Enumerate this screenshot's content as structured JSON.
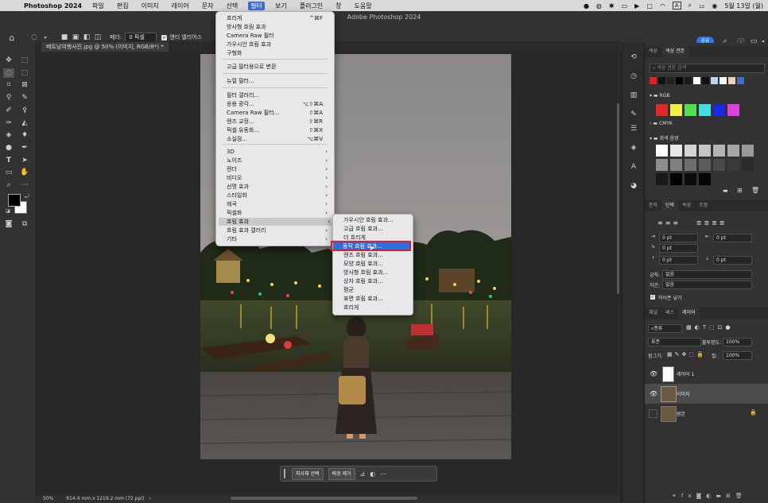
{
  "menubar": {
    "app_name": "Photoshop 2024",
    "items": [
      "파일",
      "편집",
      "이미지",
      "레이어",
      "문자",
      "선택",
      "필터",
      "보기",
      "플러그인",
      "창",
      "도움말"
    ],
    "active_index": 6,
    "status_icons": [
      "record-icon",
      "app-icon",
      "bluetooth-icon",
      "display-icon",
      "play-icon",
      "screen-icon",
      "wifi-icon",
      "input-icon",
      "search-icon",
      "control-center-icon",
      "siri-icon"
    ],
    "input_label": "A",
    "clock": "5월 13일 (월)"
  },
  "optbar": {
    "window_title": "Adobe Photoshop 2024",
    "feather_label": "페더:",
    "feather_value": "0 픽셀",
    "antialias_label": "앤티 앨리어스",
    "share_label": "공유"
  },
  "document": {
    "tab_label": "베트남여행사진.jpg @ 50% (이미지, RGB/8*) *"
  },
  "status": {
    "zoom": "50%",
    "info": "914.4 mm x 1219.2 mm (72 ppi)"
  },
  "contextbar": {
    "select_subject": "피사체 선택",
    "remove_bg": "배경 제거"
  },
  "filter_menu": {
    "items": [
      {
        "label": "흐리게",
        "shortcut": "^⌘F"
      },
      {
        "label": "방사형 흐림 효과",
        "shortcut": ""
      },
      {
        "label": "Camera Raw 필터",
        "shortcut": ""
      },
      {
        "label": "가우시안 흐림 효과",
        "shortcut": ""
      },
      {
        "label": "구형화",
        "shortcut": ""
      },
      {
        "label": "고급 필터용으로 변환",
        "shortcut": ""
      },
      {
        "label": "뉴럴 필터...",
        "shortcut": ""
      },
      {
        "label": "필터 갤러리...",
        "shortcut": ""
      },
      {
        "label": "응용 광각...",
        "shortcut": "⌥⇧⌘A"
      },
      {
        "label": "Camera Raw 필터...",
        "shortcut": "⇧⌘A"
      },
      {
        "label": "렌즈 교정...",
        "shortcut": "⇧⌘R"
      },
      {
        "label": "픽셀 유동화...",
        "shortcut": "⇧⌘X"
      },
      {
        "label": "소실점...",
        "shortcut": "⌥⌘V"
      },
      {
        "label": "3D",
        "shortcut": ""
      },
      {
        "label": "노이즈",
        "shortcut": ""
      },
      {
        "label": "렌더",
        "shortcut": ""
      },
      {
        "label": "비디오",
        "shortcut": ""
      },
      {
        "label": "선명 효과",
        "shortcut": ""
      },
      {
        "label": "스타일화",
        "shortcut": ""
      },
      {
        "label": "왜곡",
        "shortcut": ""
      },
      {
        "label": "픽셀화",
        "shortcut": ""
      },
      {
        "label": "흐림 효과",
        "shortcut": ""
      },
      {
        "label": "흐림 효과 갤러리",
        "shortcut": ""
      },
      {
        "label": "기타",
        "shortcut": ""
      }
    ]
  },
  "blur_submenu": {
    "items": [
      "가우시안 흐림 효과...",
      "고급 흐림 효과...",
      "더 흐리게",
      "동작 흐림 효과...",
      "렌즈 흐림 효과...",
      "모양 흐림 효과...",
      "방사형 흐림 효과...",
      "상자 흐림 효과...",
      "평균",
      "표면 흐림 효과...",
      "흐리게"
    ],
    "selected_index": 3
  },
  "swatches_panel": {
    "tabs": [
      "색상",
      "색상 견본"
    ],
    "search_placeholder": "색상 견본 검색",
    "recent_colors": [
      "#e02020",
      "#111111",
      "#222222",
      "#000000",
      "#1a1a1a",
      "#ffffff",
      "#111111",
      "#b8d8f0",
      "#ffffff",
      "#f0d0b0",
      "#4070c0"
    ],
    "group_rgb": "RGB",
    "rgb_colors": [
      "#e02a2a",
      "#f0f040",
      "#50e050",
      "#40e0e0",
      "#1a28e0",
      "#e040e0"
    ],
    "group_cmyk": "CMYK",
    "group_gray": "회색 음영",
    "gray_colors": [
      "#ffffff",
      "#e8e8e8",
      "#d4d4d4",
      "#c4c4c4",
      "#b4b4b4",
      "#a6a6a6",
      "#9a9a9a",
      "#8e8e8e",
      "#808080",
      "#6e6e6e",
      "#5c5c5c",
      "#4a4a4a",
      "#3a3a3a",
      "#2a2a2a",
      "#1a1a1a",
      "#000000",
      "#0c0c0c",
      "#050505"
    ]
  },
  "paragraph_panel": {
    "tabs": [
      "문자",
      "단락",
      "속성",
      "조정"
    ],
    "indent_values": [
      "0 pt",
      "0 pt",
      "0 pt",
      "0 pt",
      "0 pt"
    ],
    "justify_label": "금칙:",
    "justify_value": "없음",
    "spacing_label": "자간:",
    "spacing_value": "없음",
    "hyphen_label": "하이픈 넣기"
  },
  "layers_panel": {
    "tabs": [
      "채널",
      "패스",
      "레이어"
    ],
    "filter_label": "종류",
    "blend_mode": "표준",
    "opacity_label": "불투명도:",
    "opacity_value": "100%",
    "lock_label": "잠그기:",
    "fill_label": "칠:",
    "fill_value": "100%",
    "layers": [
      {
        "name": "레이어 1",
        "visible": true,
        "selected": false
      },
      {
        "name": "이미지",
        "visible": true,
        "selected": true
      },
      {
        "name": "원본",
        "visible": false,
        "selected": false
      }
    ]
  }
}
